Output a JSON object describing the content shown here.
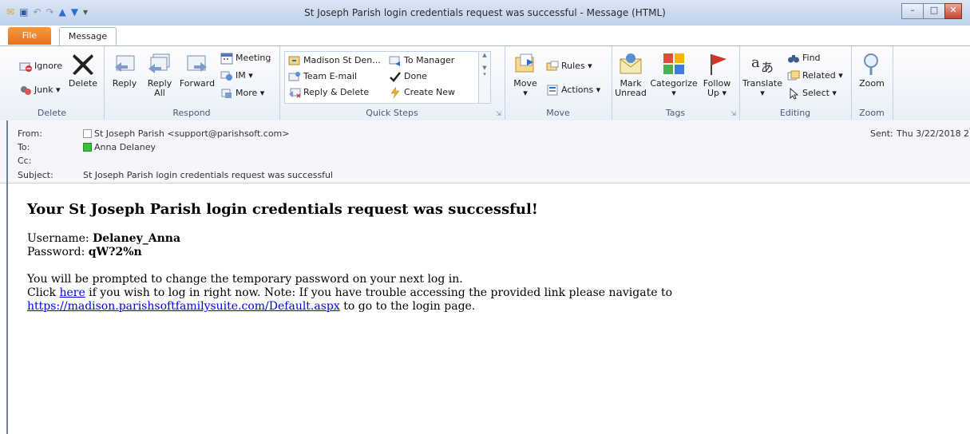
{
  "window": {
    "title": "St Joseph Parish login credentials request was successful  -  Message (HTML)"
  },
  "tabs": {
    "file": "File",
    "message": "Message"
  },
  "ribbon": {
    "delete_group": {
      "label": "Delete",
      "ignore": "Ignore",
      "junk": "Junk ▾",
      "delete": "Delete"
    },
    "respond_group": {
      "label": "Respond",
      "reply": "Reply",
      "reply_all_1": "Reply",
      "reply_all_2": "All",
      "forward": "Forward",
      "meeting": "Meeting",
      "im": "IM ▾",
      "more": "More ▾"
    },
    "quicksteps_group": {
      "label": "Quick Steps",
      "item1": "Madison St Den...",
      "item2": "To Manager",
      "item3": "Team E-mail",
      "item4": "Done",
      "item5": "Reply & Delete",
      "item6": "Create New"
    },
    "move_group": {
      "label": "Move",
      "move": "Move",
      "move_arrow": "▾",
      "rules": "Rules ▾",
      "actions": "Actions ▾"
    },
    "tags_group": {
      "label": "Tags",
      "mark_unread_1": "Mark",
      "mark_unread_2": "Unread",
      "categorize_1": "Categorize",
      "categorize_2": "▾",
      "follow_1": "Follow",
      "follow_2": "Up ▾"
    },
    "editing_group": {
      "label": "Editing",
      "translate_1": "Translate",
      "translate_2": "▾",
      "find": "Find",
      "related": "Related ▾",
      "select": "Select ▾"
    },
    "zoom_group": {
      "label": "Zoom",
      "zoom": "Zoom"
    }
  },
  "header": {
    "from_label": "From:",
    "from_value": "St Joseph Parish <support@parishsoft.com>",
    "to_label": "To:",
    "to_value": "Anna Delaney",
    "cc_label": "Cc:",
    "subject_label": "Subject:",
    "subject_value": "St Joseph Parish login credentials request was successful",
    "sent_label": "Sent:",
    "sent_value": "Thu 3/22/2018 2"
  },
  "body": {
    "heading": "Your St Joseph Parish login credentials request was successful!",
    "username_label": "Username: ",
    "username_value": "Delaney_Anna",
    "password_label": "Password: ",
    "password_value": "qW?2%n",
    "prompt_text": "You will be prompted to change the temporary password on your next log in.",
    "click_text": "Click ",
    "here_link": "here",
    "note_text": " if you wish to log in right now. Note: If you have trouble accessing the provided link please navigate to ",
    "url_link": "https://madison.parishsoftfamilysuite.com/Default.aspx",
    "tail_text": " to go to the login page."
  }
}
